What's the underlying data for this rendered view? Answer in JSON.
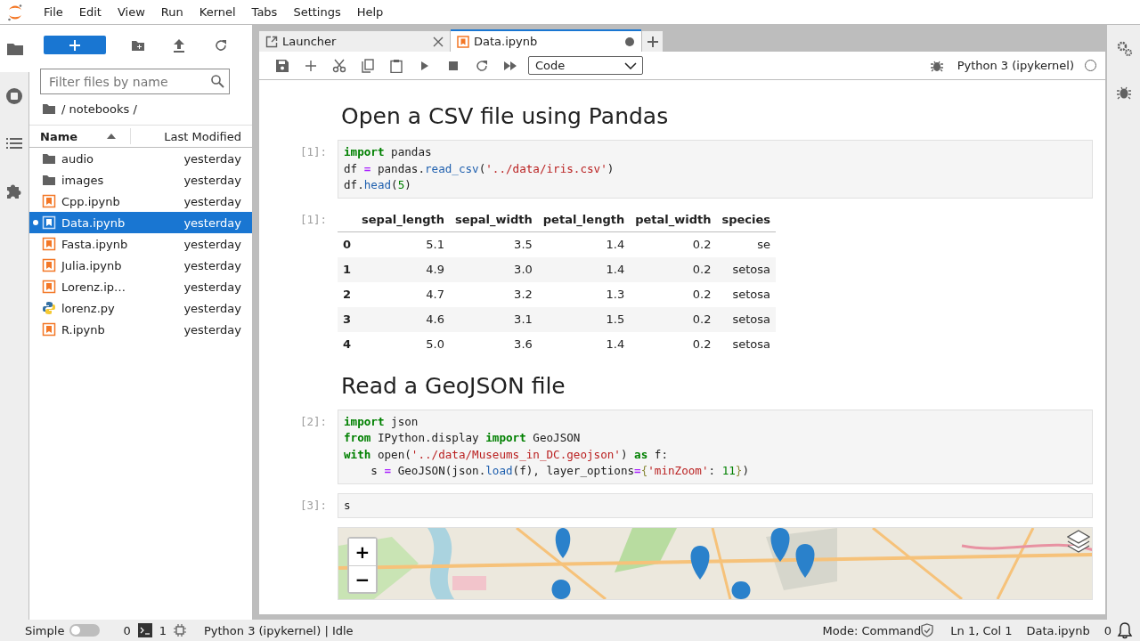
{
  "menu": [
    "File",
    "Edit",
    "View",
    "Run",
    "Kernel",
    "Tabs",
    "Settings",
    "Help"
  ],
  "left_sidebar": [
    {
      "kind": "files",
      "selected": true
    },
    {
      "kind": "running",
      "selected": false
    },
    {
      "kind": "toc",
      "selected": false
    },
    {
      "kind": "extensions",
      "selected": false
    }
  ],
  "file_browser": {
    "filter": {
      "placeholder": "Filter files by name"
    },
    "path": "/ notebooks /",
    "columns": [
      "Name",
      "Last Modified"
    ],
    "files": [
      {
        "kind": "folder",
        "name": "audio",
        "modified": "yesterday",
        "selected": false,
        "running": false
      },
      {
        "kind": "folder",
        "name": "images",
        "modified": "yesterday",
        "selected": false,
        "running": false
      },
      {
        "kind": "notebook",
        "name": "Cpp.ipynb",
        "modified": "yesterday",
        "selected": false,
        "running": false
      },
      {
        "kind": "notebook",
        "name": "Data.ipynb",
        "modified": "yesterday",
        "selected": true,
        "running": true
      },
      {
        "kind": "notebook",
        "name": "Fasta.ipynb",
        "modified": "yesterday",
        "selected": false,
        "running": false
      },
      {
        "kind": "notebook",
        "name": "Julia.ipynb",
        "modified": "yesterday",
        "selected": false,
        "running": false
      },
      {
        "kind": "notebook",
        "name": "Lorenz.ip…",
        "modified": "yesterday",
        "selected": false,
        "running": false
      },
      {
        "kind": "python",
        "name": "lorenz.py",
        "modified": "yesterday",
        "selected": false,
        "running": false
      },
      {
        "kind": "notebook",
        "name": "R.ipynb",
        "modified": "yesterday",
        "selected": false,
        "running": false
      }
    ]
  },
  "tabs": [
    {
      "kind": "launcher",
      "label": "Launcher",
      "selected": false,
      "dirty": false
    },
    {
      "kind": "notebook",
      "label": "Data.ipynb",
      "selected": true,
      "dirty": true
    }
  ],
  "toolbar": {
    "cell_type": "Code",
    "kernel": "Python 3 (ipykernel)",
    "kernel_busy": false
  },
  "cells": [
    {
      "kind": "markdown",
      "text": "Open a CSV file using Pandas"
    },
    {
      "kind": "code",
      "prompt": "[1]:",
      "lines": [
        [
          {
            "text": "import",
            "kind": "kw"
          },
          {
            "text": " pandas",
            "kind": "plain"
          }
        ],
        [
          {
            "text": "df ",
            "kind": "plain"
          },
          {
            "text": "=",
            "kind": "op"
          },
          {
            "text": " pandas.",
            "kind": "plain"
          },
          {
            "text": "read_csv",
            "kind": "fn"
          },
          {
            "text": "(",
            "kind": "plain"
          },
          {
            "text": "'../data/iris.csv'",
            "kind": "str"
          },
          {
            "text": ")",
            "kind": "plain"
          }
        ],
        [
          {
            "text": "df.",
            "kind": "plain"
          },
          {
            "text": "head",
            "kind": "fn"
          },
          {
            "text": "(",
            "kind": "plain"
          },
          {
            "text": "5",
            "kind": "num"
          },
          {
            "text": ")",
            "kind": "plain"
          }
        ]
      ]
    },
    {
      "kind": "table",
      "prompt": "[1]:",
      "columns": [
        "",
        "sepal_length",
        "sepal_width",
        "petal_length",
        "petal_width",
        "species"
      ],
      "rows": [
        [
          "0",
          "5.1",
          "3.5",
          "1.4",
          "0.2",
          "se"
        ],
        [
          "1",
          "4.9",
          "3.0",
          "1.4",
          "0.2",
          "setosa"
        ],
        [
          "2",
          "4.7",
          "3.2",
          "1.3",
          "0.2",
          "setosa"
        ],
        [
          "3",
          "4.6",
          "3.1",
          "1.5",
          "0.2",
          "setosa"
        ],
        [
          "4",
          "5.0",
          "3.6",
          "1.4",
          "0.2",
          "setosa"
        ]
      ]
    },
    {
      "kind": "markdown",
      "text": "Read a GeoJSON file"
    },
    {
      "kind": "code",
      "prompt": "[2]:",
      "lines": [
        [
          {
            "text": "import",
            "kind": "kw"
          },
          {
            "text": " json",
            "kind": "plain"
          }
        ],
        [
          {
            "text": "from",
            "kind": "kw"
          },
          {
            "text": " IPython.display ",
            "kind": "plain"
          },
          {
            "text": "import",
            "kind": "kw"
          },
          {
            "text": " GeoJSON",
            "kind": "plain"
          }
        ],
        [
          {
            "text": "with",
            "kind": "kw"
          },
          {
            "text": " open(",
            "kind": "plain"
          },
          {
            "text": "'../data/Museums_in_DC.geojson'",
            "kind": "str"
          },
          {
            "text": ") ",
            "kind": "plain"
          },
          {
            "text": "as",
            "kind": "kw"
          },
          {
            "text": " f:",
            "kind": "plain"
          }
        ],
        [
          {
            "text": "    s ",
            "kind": "plain"
          },
          {
            "text": "=",
            "kind": "op"
          },
          {
            "text": " GeoJSON(json.",
            "kind": "plain"
          },
          {
            "text": "load",
            "kind": "fn"
          },
          {
            "text": "(f), layer_options",
            "kind": "plain"
          },
          {
            "text": "=",
            "kind": "op"
          },
          {
            "text": "{",
            "kind": "punc"
          },
          {
            "text": "'minZoom'",
            "kind": "str"
          },
          {
            "text": ": ",
            "kind": "plain"
          },
          {
            "text": "11",
            "kind": "num"
          },
          {
            "text": "}",
            "kind": "punc"
          },
          {
            "text": ")",
            "kind": "plain"
          }
        ]
      ]
    },
    {
      "kind": "code",
      "prompt": "[3]:",
      "lines": [
        [
          {
            "text": "s",
            "kind": "plain"
          }
        ]
      ]
    },
    {
      "kind": "map",
      "zoom_in": "+",
      "zoom_out": "−"
    }
  ],
  "status_bar": {
    "mode_label": "Simple",
    "simple_on": false,
    "terminals": "0",
    "kernels": "1",
    "kernel_status": "Python 3 (ipykernel) | Idle",
    "mode": "Mode: Command",
    "position": "Ln 1, Col 1",
    "file": "Data.ipynb",
    "notifications": "0"
  }
}
